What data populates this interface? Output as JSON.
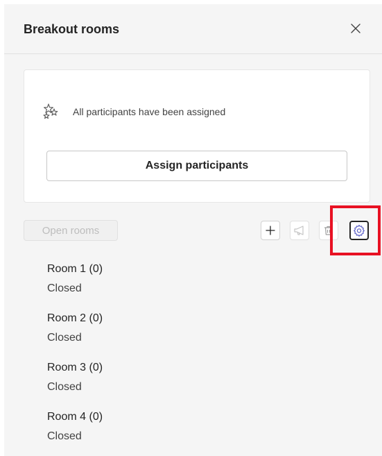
{
  "header": {
    "title": "Breakout rooms",
    "close_icon": "close-icon"
  },
  "assignment": {
    "status_icon": "sparkle-stars-icon",
    "status_text": "All participants have been assigned",
    "assign_label": "Assign participants"
  },
  "toolbar": {
    "open_rooms_label": "Open rooms",
    "add_icon": "add-icon",
    "announce_icon": "megaphone-icon",
    "delete_icon": "trash-icon",
    "settings_icon": "gear-icon"
  },
  "colors": {
    "highlight": "#e81123",
    "settings_accent": "#5b5fc7"
  },
  "rooms": [
    {
      "name": "Room 1",
      "count": "(0)",
      "status": "Closed"
    },
    {
      "name": "Room 2",
      "count": "(0)",
      "status": "Closed"
    },
    {
      "name": "Room 3",
      "count": "(0)",
      "status": "Closed"
    },
    {
      "name": "Room 4",
      "count": "(0)",
      "status": "Closed"
    }
  ]
}
